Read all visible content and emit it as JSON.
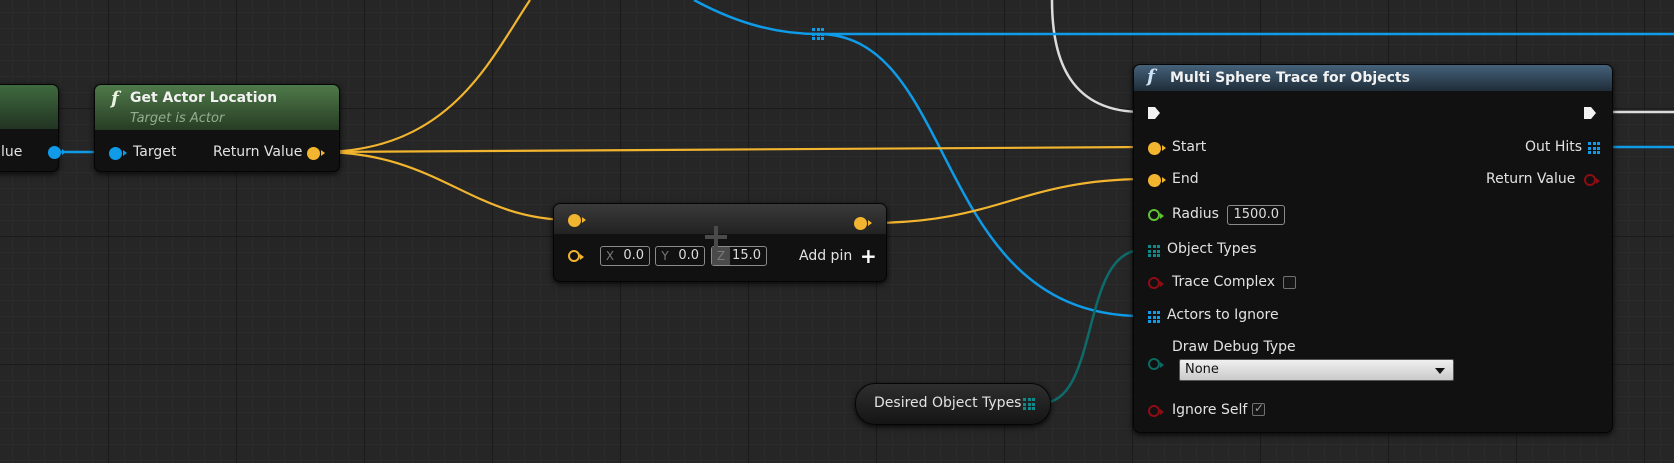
{
  "colors": {
    "vector": "#f2b52f",
    "object": "#0f9be8",
    "bool": "#8c0d13",
    "float": "#5fc235",
    "object_type": "#0e8a8a",
    "enum": "#0a6a62",
    "exec": "#f2f2f2"
  },
  "partial_node": {
    "pin_label": "lue"
  },
  "get_actor_location": {
    "title": "Get Actor Location",
    "subtitle": "Target is Actor",
    "target_label": "Target",
    "return_label": "Return Value",
    "icon": "function-icon"
  },
  "make_vector": {
    "x_axis": "X",
    "x_value": "0.0",
    "y_axis": "Y",
    "y_value": "0.0",
    "z_axis": "Z",
    "z_value": "15.0",
    "add_pin_label": "Add pin",
    "add_pin_icon": "plus-icon"
  },
  "trace_node": {
    "title": "Multi Sphere Trace for Objects",
    "icon": "function-icon",
    "start_label": "Start",
    "end_label": "End",
    "radius_label": "Radius",
    "radius_value": "1500.0",
    "object_types_label": "Object Types",
    "trace_complex_label": "Trace Complex",
    "trace_complex_checked": false,
    "actors_to_ignore_label": "Actors to Ignore",
    "draw_debug_label": "Draw Debug Type",
    "draw_debug_value": "None",
    "ignore_self_label": "Ignore Self",
    "ignore_self_checked": true,
    "out_hits_label": "Out Hits",
    "return_value_label": "Return Value"
  },
  "desired_object_types": {
    "label": "Desired Object Types"
  }
}
